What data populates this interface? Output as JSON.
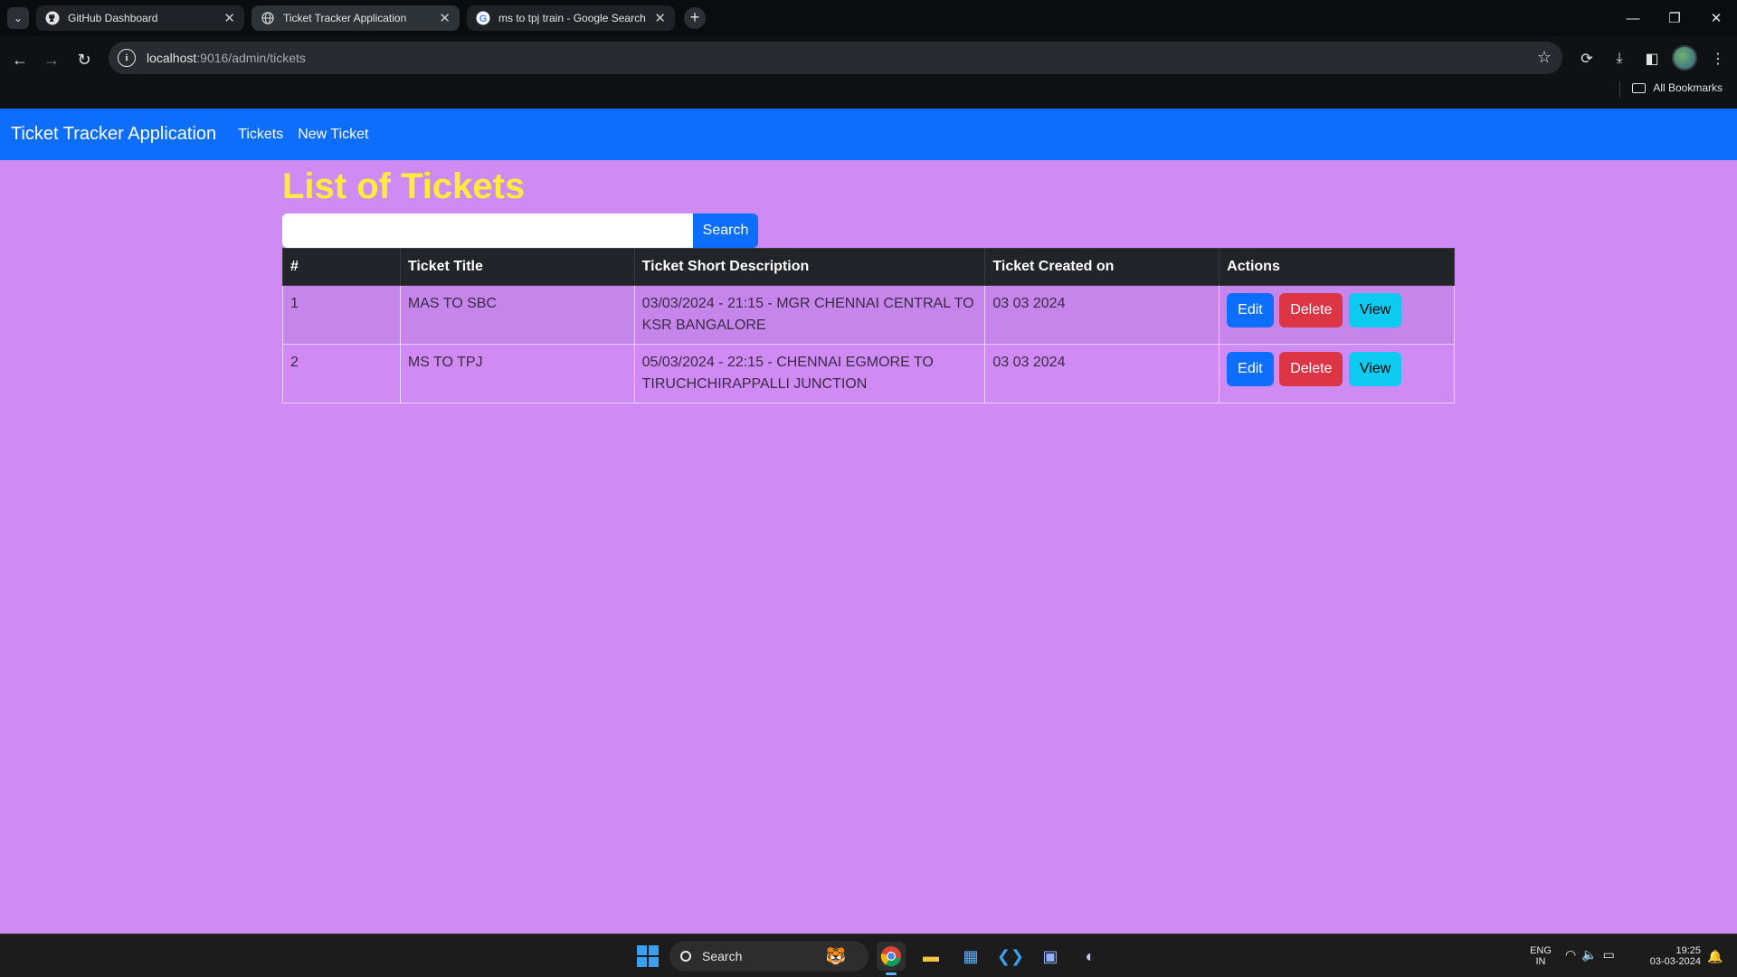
{
  "browser": {
    "tabs": [
      {
        "title": "GitHub Dashboard",
        "icon": "github-icon",
        "active": false
      },
      {
        "title": "Ticket Tracker Application",
        "icon": "globe-icon",
        "active": true
      },
      {
        "title": "ms to tpj train - Google Search",
        "icon": "google-icon",
        "active": false
      }
    ],
    "url_host": "localhost",
    "url_rest": ":9016/admin/tickets",
    "bookmarks_label": "All Bookmarks"
  },
  "app": {
    "brand": "Ticket Tracker Application",
    "nav": [
      "Tickets",
      "New Ticket"
    ],
    "page_title": "List of Tickets",
    "search": {
      "value": "",
      "placeholder": "",
      "button": "Search"
    },
    "table": {
      "headers": [
        "#",
        "Ticket Title",
        "Ticket Short Description",
        "Ticket Created on",
        "Actions"
      ],
      "rows": [
        {
          "num": "1",
          "title": "MAS TO SBC",
          "description": "03/03/2024 - 21:15 - MGR CHENNAI CENTRAL TO KSR BANGALORE",
          "created": "03 03 2024"
        },
        {
          "num": "2",
          "title": "MS TO TPJ",
          "description": "05/03/2024 - 22:15 - CHENNAI EGMORE TO TIRUCHCHIRAPPALLI JUNCTION",
          "created": "03 03 2024"
        }
      ],
      "actions": {
        "edit": "Edit",
        "delete": "Delete",
        "view": "View"
      }
    }
  },
  "taskbar": {
    "search_label": "Search",
    "lang": "ENG",
    "region": "IN",
    "time": "19:25",
    "date": "03-03-2024"
  },
  "colors": {
    "page_bg": "#cf8af3",
    "navbar": "#0d6efd",
    "title": "#ffeb3b",
    "table_header": "#212529",
    "edit": "#0d6efd",
    "delete": "#dc3545",
    "view": "#0dcaf0"
  }
}
